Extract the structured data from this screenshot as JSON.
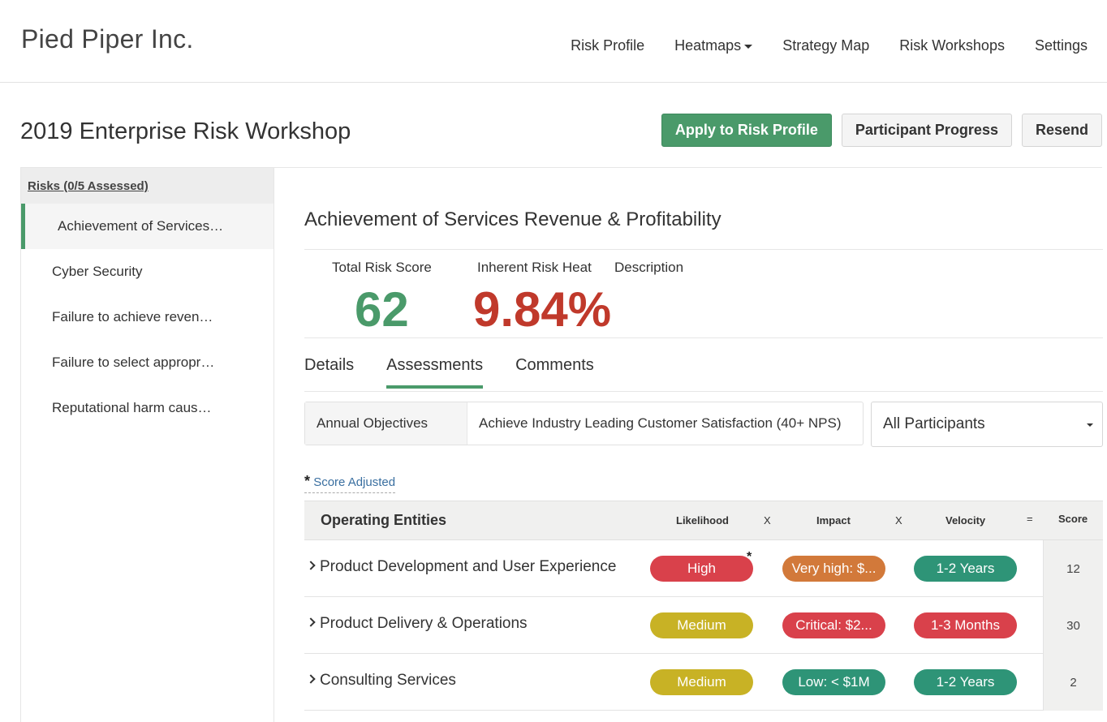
{
  "header": {
    "brand": "Pied Piper Inc.",
    "nav": [
      "Risk Profile",
      "Heatmaps",
      "Strategy Map",
      "Risk Workshops",
      "Settings"
    ]
  },
  "page": {
    "title": "2019 Enterprise Risk Workshop",
    "buttons": {
      "apply": "Apply to Risk Profile",
      "progress": "Participant Progress",
      "resend": "Resend"
    }
  },
  "sidebar": {
    "header": "Risks (0/5 Assessed)",
    "items": [
      "Achievement of Services…",
      "Cyber Security",
      "Failure to achieve reven…",
      "Failure to select appropr…",
      "Reputational harm caus…"
    ]
  },
  "risk": {
    "title": "Achievement of Services Revenue & Profitability",
    "total_label": "Total Risk Score",
    "total_value": "62",
    "inherent_label": "Inherent Risk Heat",
    "inherent_value": "9.84%",
    "description_label": "Description"
  },
  "tabs": [
    "Details",
    "Assessments",
    "Comments"
  ],
  "objectives": {
    "label": "Annual Objectives",
    "value": "Achieve Industry Leading Customer Satisfaction (40+ NPS)"
  },
  "participants_select": "All Participants",
  "score_adjusted": {
    "asterisk": "*",
    "label": "Score Adjusted"
  },
  "table": {
    "header": {
      "entity": "Operating Entities",
      "likelihood": "Likelihood",
      "x1": "X",
      "impact": "Impact",
      "x2": "X",
      "velocity": "Velocity",
      "eq": "=",
      "score": "Score"
    },
    "rows": [
      {
        "name": "Product Development and User Experience",
        "likelihood": "High",
        "likelihood_adjusted": "*",
        "impact": "Very high: $...",
        "velocity": "1-2 Years",
        "score": "12"
      },
      {
        "name": "Product Delivery & Operations",
        "likelihood": "Medium",
        "impact": "Critical: $2...",
        "velocity": "1-3 Months",
        "score": "30"
      },
      {
        "name": "Consulting Services",
        "likelihood": "Medium",
        "impact": "Low: < $1M",
        "velocity": "1-2 Years",
        "score": "2"
      }
    ]
  },
  "colors": {
    "green": "#4a9a6a",
    "red_text": "#c0392b",
    "pill_red": "#d9414b",
    "pill_orange": "#d2793a",
    "pill_teal": "#2e9477",
    "pill_yellow": "#c8b225"
  }
}
